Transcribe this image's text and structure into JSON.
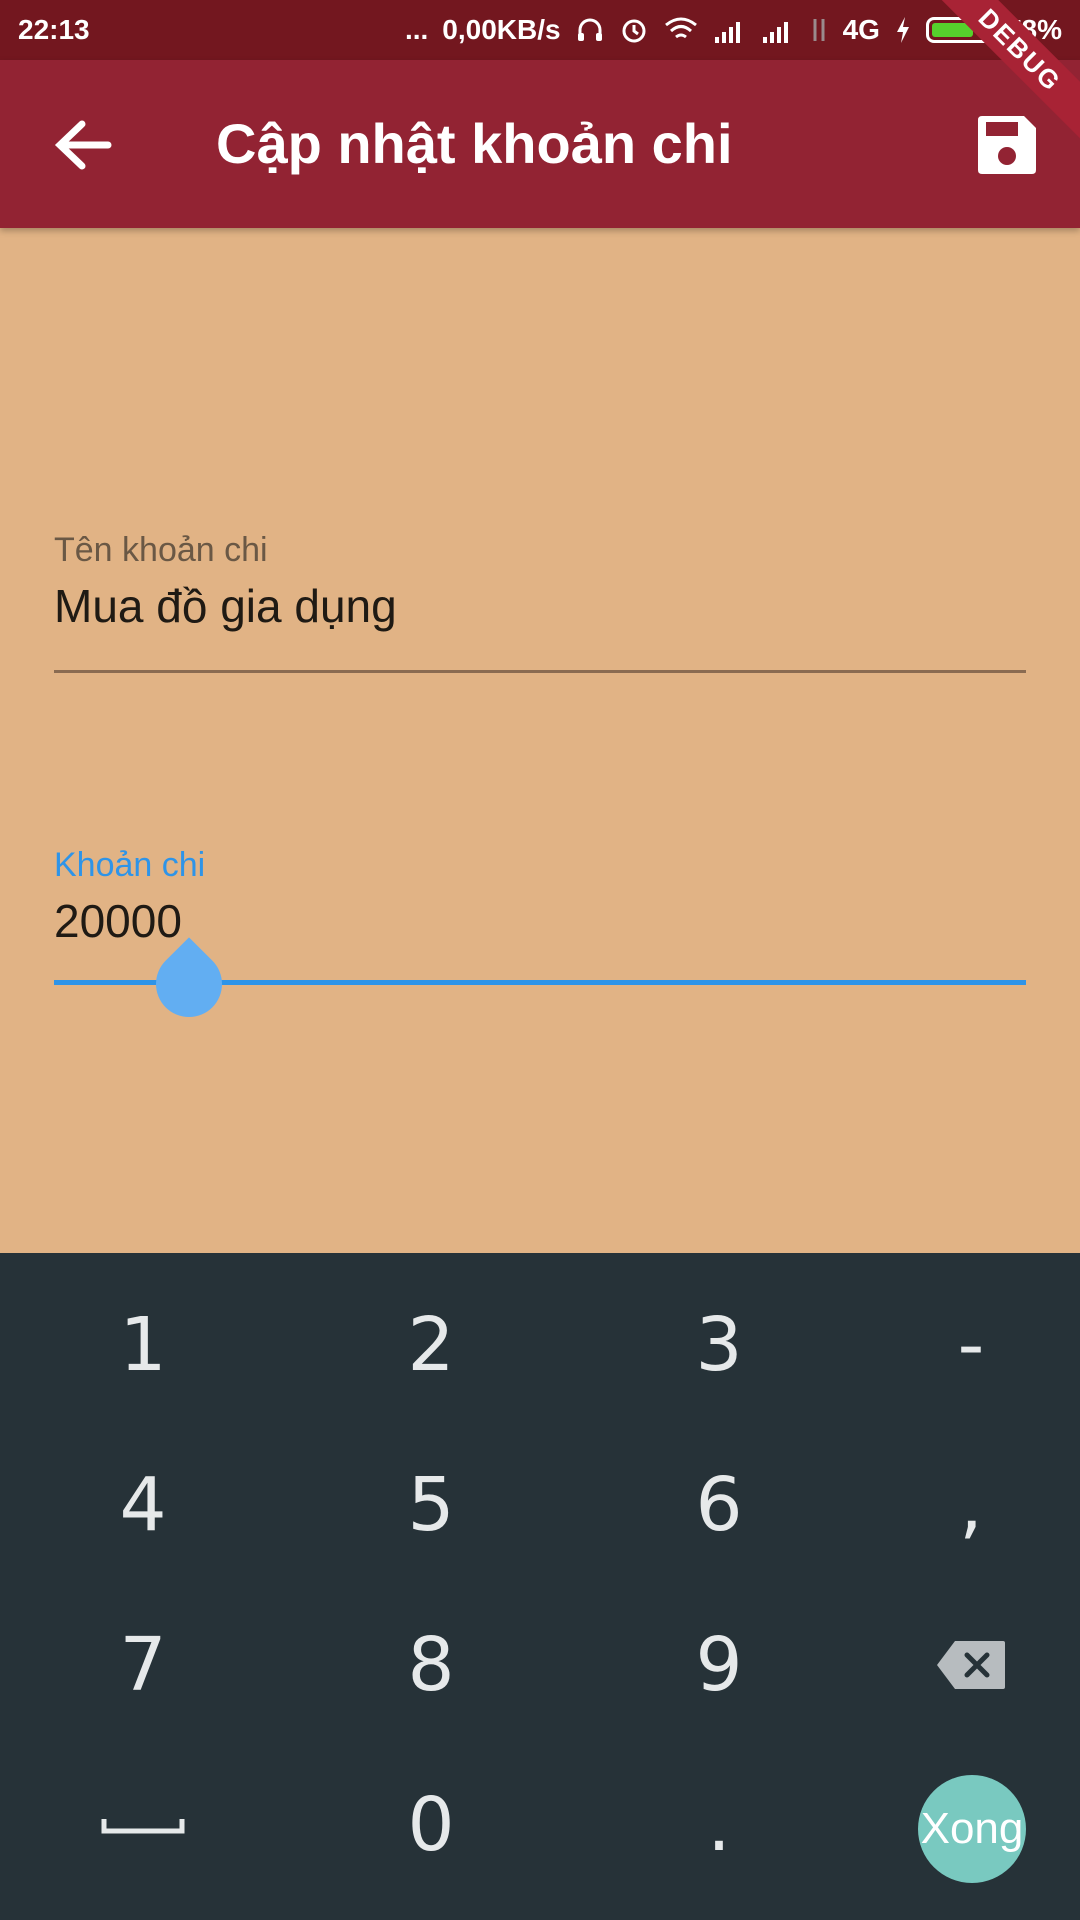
{
  "status_bar": {
    "time": "22:13",
    "dots": "...",
    "network_speed": "0,00KB/s",
    "network_type": "4G",
    "battery_percent": "78%",
    "battery_level": 0.78,
    "icons": [
      "headphones-icon",
      "alarm-icon",
      "wifi-icon",
      "signal-icon",
      "signal-icon",
      "data-arrows-icon",
      "charging-icon",
      "battery-icon"
    ]
  },
  "app_bar": {
    "title": "Cập nhật khoản chi",
    "back_icon": "arrow-back-icon",
    "save_icon": "save-icon",
    "debug_label": "DEBUG"
  },
  "form": {
    "name_field": {
      "label": "Tên khoản chi",
      "value": "Mua đồ gia dụng"
    },
    "amount_field": {
      "label": "Khoản chi",
      "value": "20000"
    }
  },
  "keyboard": {
    "keys": [
      "1",
      "2",
      "3",
      "-",
      "4",
      "5",
      "6",
      ",",
      "7",
      "8",
      "9",
      "backspace",
      "space",
      "0",
      ".",
      "Xong"
    ],
    "done_label": "Xong"
  },
  "colors": {
    "status_bar": "#73171f",
    "app_bar": "#922333",
    "background": "#e1b385",
    "accent": "#2e94e8",
    "keyboard": "#263238",
    "done_button": "#79c9c0"
  }
}
